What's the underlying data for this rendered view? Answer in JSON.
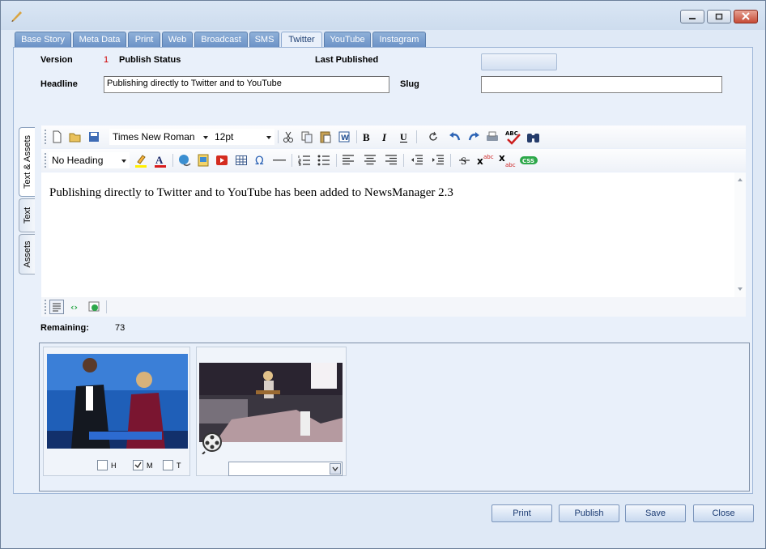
{
  "tabs": [
    "Base Story",
    "Meta Data",
    "Print",
    "Web",
    "Broadcast",
    "SMS",
    "Twitter",
    "YouTube",
    "Instagram"
  ],
  "active_tab": "Twitter",
  "form": {
    "version_label": "Version",
    "version_value": "1",
    "publish_status_label": "Publish Status",
    "last_published_label": "Last Published",
    "headline_label": "Headline",
    "headline_value": "Publishing directly to Twitter and to YouTube",
    "slug_label": "Slug",
    "slug_value": ""
  },
  "side_tabs": [
    "Text & Assets",
    "Text",
    "Assets"
  ],
  "toolbar": {
    "font_name": "Times New Roman",
    "font_size": "12pt",
    "heading": "No Heading"
  },
  "editor": {
    "content": "Publishing directly to Twitter and to YouTube has been added to NewsManager 2.3"
  },
  "remaining": {
    "label": "Remaining:",
    "value": "73"
  },
  "assets": {
    "checkboxes": [
      {
        "label": "H",
        "checked": false
      },
      {
        "label": "M",
        "checked": true
      },
      {
        "label": "T",
        "checked": false
      }
    ],
    "video_select_value": ""
  },
  "buttons": {
    "print": "Print",
    "publish": "Publish",
    "save": "Save",
    "close": "Close"
  },
  "colors": {
    "accent": "#6a91c6",
    "version_value": "#d00000"
  }
}
